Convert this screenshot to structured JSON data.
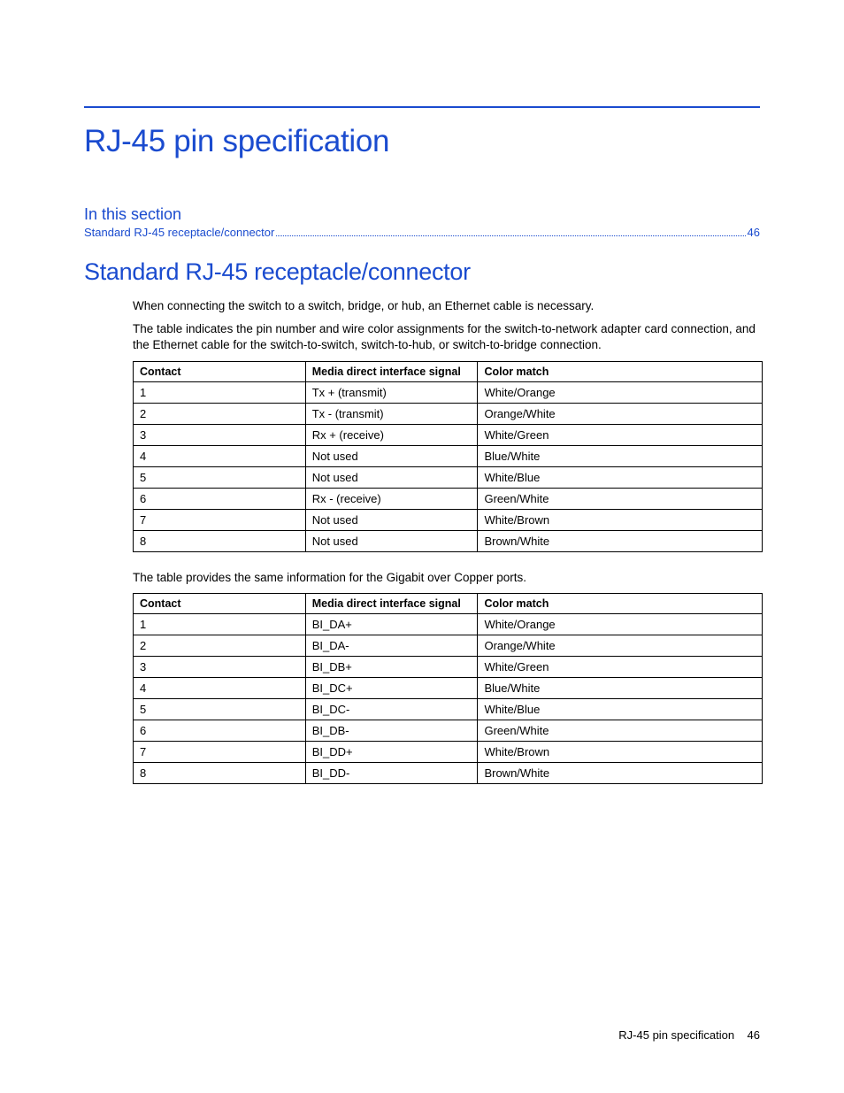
{
  "page": {
    "title": "RJ-45 pin specification",
    "footer_label": "RJ-45 pin specification",
    "footer_page": "46"
  },
  "toc": {
    "heading": "In this section",
    "entry_label": "Standard RJ-45 receptacle/connector",
    "entry_page": "46"
  },
  "section": {
    "heading": "Standard RJ-45 receptacle/connector",
    "intro_p1": "When connecting the switch to a switch, bridge, or hub, an Ethernet cable is necessary.",
    "intro_p2": "The table indicates the pin number and wire color assignments for the switch-to-network adapter card connection, and the Ethernet cable for the switch-to-switch, switch-to-hub, or switch-to-bridge connection.",
    "mid_p": "The table provides the same information for the Gigabit over Copper ports."
  },
  "table_headers": {
    "contact": "Contact",
    "signal": "Media direct interface signal",
    "color": "Color match"
  },
  "table1": [
    {
      "contact": "1",
      "signal": "Tx + (transmit)",
      "color": "White/Orange"
    },
    {
      "contact": "2",
      "signal": "Tx - (transmit)",
      "color": "Orange/White"
    },
    {
      "contact": "3",
      "signal": "Rx + (receive)",
      "color": "White/Green"
    },
    {
      "contact": "4",
      "signal": "Not used",
      "color": "Blue/White"
    },
    {
      "contact": "5",
      "signal": "Not used",
      "color": "White/Blue"
    },
    {
      "contact": "6",
      "signal": "Rx - (receive)",
      "color": "Green/White"
    },
    {
      "contact": "7",
      "signal": "Not used",
      "color": "White/Brown"
    },
    {
      "contact": "8",
      "signal": "Not used",
      "color": "Brown/White"
    }
  ],
  "table2": [
    {
      "contact": "1",
      "signal": "BI_DA+",
      "color": "White/Orange"
    },
    {
      "contact": "2",
      "signal": "BI_DA-",
      "color": "Orange/White"
    },
    {
      "contact": "3",
      "signal": "BI_DB+",
      "color": "White/Green"
    },
    {
      "contact": "4",
      "signal": "BI_DC+",
      "color": "Blue/White"
    },
    {
      "contact": "5",
      "signal": "BI_DC-",
      "color": "White/Blue"
    },
    {
      "contact": "6",
      "signal": "BI_DB-",
      "color": "Green/White"
    },
    {
      "contact": "7",
      "signal": "BI_DD+",
      "color": "White/Brown"
    },
    {
      "contact": "8",
      "signal": "BI_DD-",
      "color": "Brown/White"
    }
  ]
}
